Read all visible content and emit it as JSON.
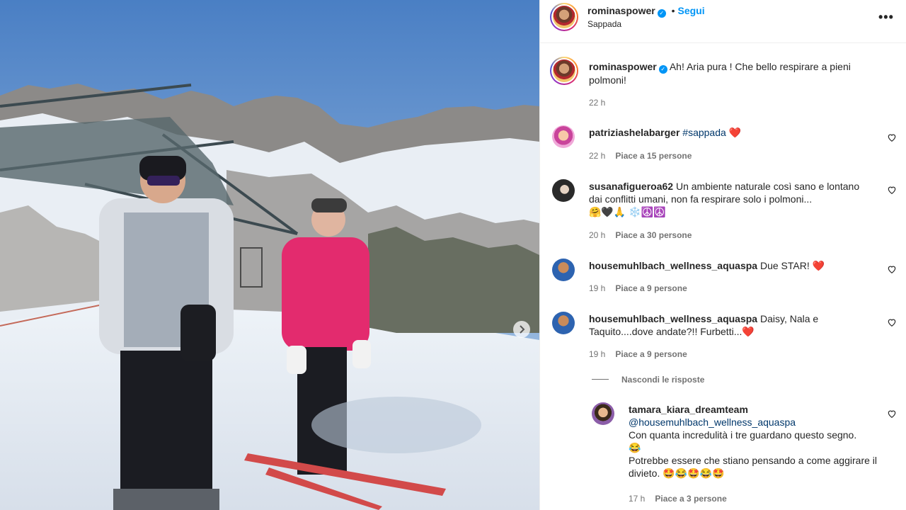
{
  "post": {
    "author": "rominaspower",
    "location": "Sappada",
    "follow_label": "Segui",
    "dot": "•",
    "more": "•••",
    "caption": "Ah! Aria pura ! Che bello respirare a pieni polmoni!",
    "time": "22 h"
  },
  "comments": [
    {
      "user": "patriziashelabarger",
      "text": "#sappada",
      "emoji": "❤️",
      "time": "22 h",
      "likes": "Piace a 15 persone"
    },
    {
      "user": "susanafigueroa62",
      "text": "Un ambiente naturale così sano e lontano dai conflitti umani, non fa respirare solo i polmoni...",
      "emoji": "🤗🖤🙏 ❄️☮️☮️",
      "time": "20 h",
      "likes": "Piace a 30 persone"
    },
    {
      "user": "housemuhlbach_wellness_aquaspa",
      "text": "Due STAR!",
      "emoji": "❤️",
      "time": "19 h",
      "likes": "Piace a 9 persone"
    },
    {
      "user": "housemuhlbach_wellness_aquaspa",
      "text": "Daisy, Nala e Taquito....dove andate?!! Furbetti...",
      "emoji": "❤️",
      "time": "19 h",
      "likes": "Piace a 9 persone"
    }
  ],
  "hide_replies": "Nascondi le risposte",
  "reply": {
    "user": "tamara_kiara_dreamteam",
    "mention": "@housemuhlbach_wellness_aquaspa",
    "line1": "Con quanta incredulità i tre guardano questo segno.",
    "emoji1": "😂",
    "line2": "Potrebbe essere che stiano pensando a come aggirare il divieto.",
    "emoji2": "🤩😂🤩😂🤩",
    "time": "17 h",
    "likes": "Piace a 3 persone"
  },
  "icons": {
    "verified": "verified-badge-icon",
    "heart": "heart-outline-icon",
    "next": "chevron-right-icon",
    "more": "more-options-icon"
  },
  "colors": {
    "link": "#0095f6",
    "verified": "#0095f6",
    "meta": "#737373",
    "heart_red": "#ed4956"
  }
}
